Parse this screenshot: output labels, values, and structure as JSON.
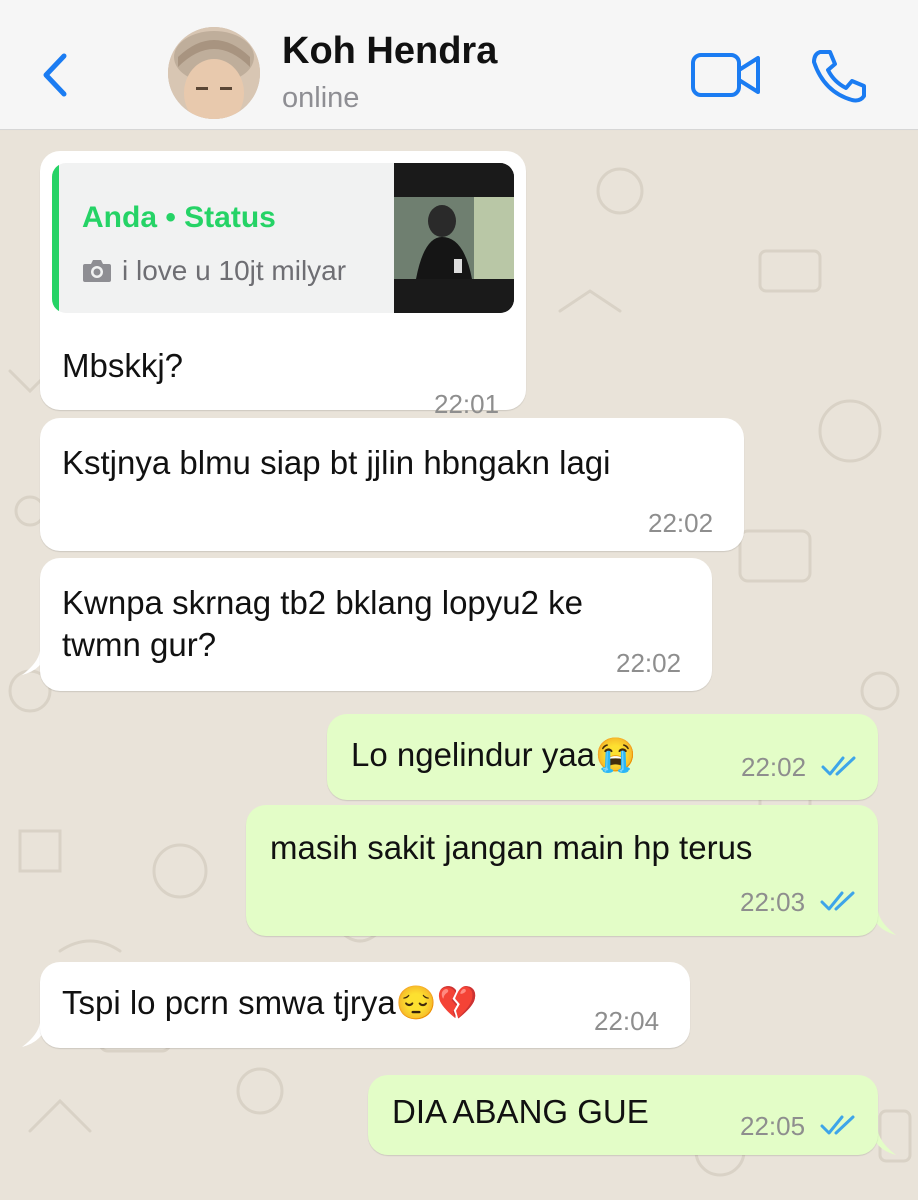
{
  "header": {
    "name": "Koh Hendra",
    "status": "online"
  },
  "icons": {
    "back": "chevron-left-icon",
    "video": "video-camera-icon",
    "call": "phone-icon",
    "camera": "camera-icon",
    "read_receipt": "double-check-icon"
  },
  "colors": {
    "accent": "#1b7cf2",
    "status_green": "#25d366",
    "outgoing_bubble": "#e3fdc7",
    "incoming_bubble": "#ffffff",
    "read_tick": "#3ea5e9"
  },
  "reply": {
    "title": "Anda • Status",
    "subtitle": "i love u 10jt milyar"
  },
  "messages": [
    {
      "direction": "in",
      "text": "Mbskkj?",
      "time": "22:01"
    },
    {
      "direction": "in",
      "text": "Kstjnya blmu siap bt jjlin hbngakn lagi",
      "time": "22:02"
    },
    {
      "direction": "in",
      "text": "Kwnpa skrnag tb2 bklang lopyu2 ke\ntwmn gur?",
      "time": "22:02"
    },
    {
      "direction": "out",
      "text": "Lo ngelindur yaa😭",
      "time": "22:02"
    },
    {
      "direction": "out",
      "text": "masih sakit jangan main hp terus",
      "time": "22:03"
    },
    {
      "direction": "in",
      "text": "Tspi lo pcrn smwa tjrya😔💔",
      "time": "22:04"
    },
    {
      "direction": "out",
      "text": "DIA ABANG GUE",
      "time": "22:05"
    }
  ]
}
